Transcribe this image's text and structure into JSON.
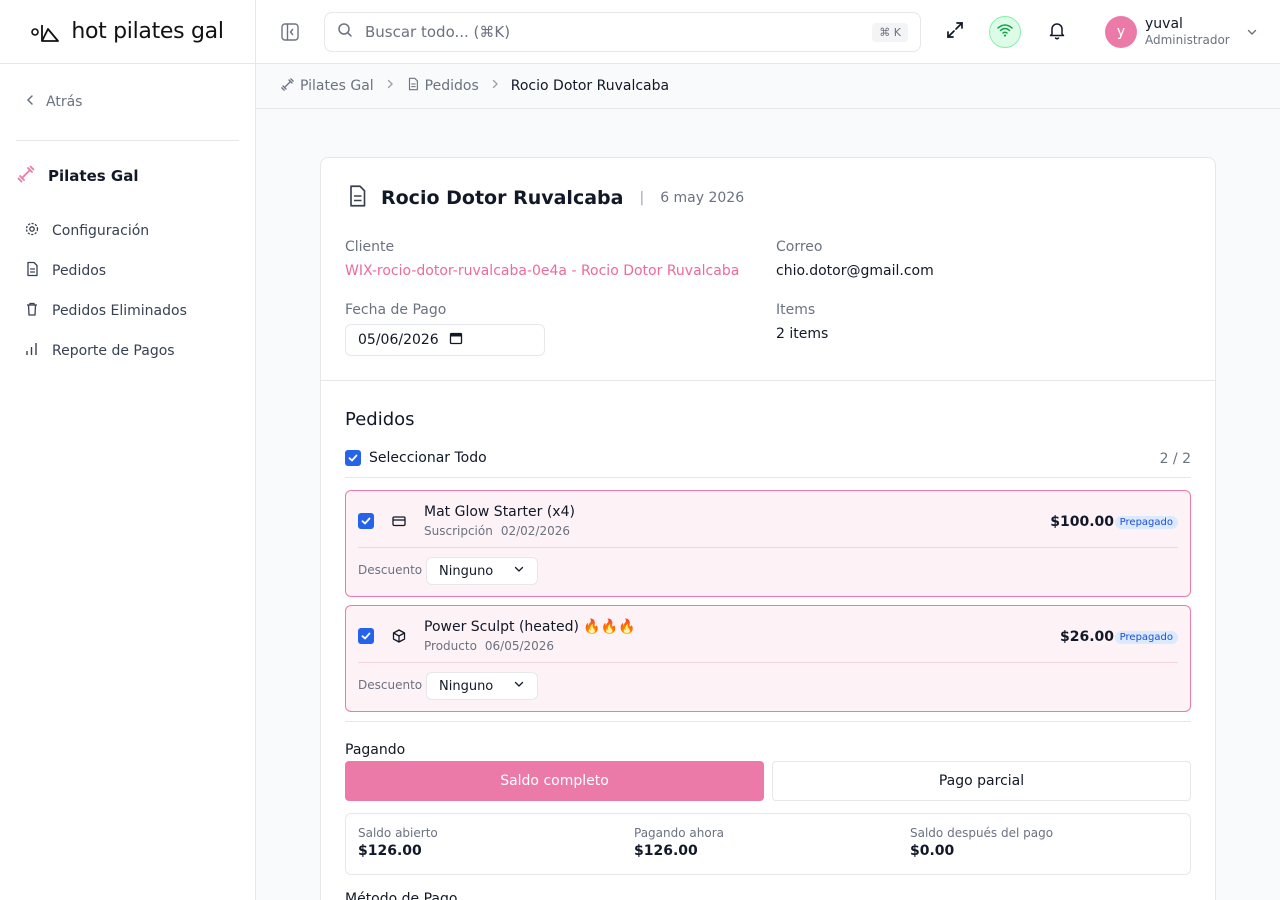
{
  "app": {
    "logo_text": "hot pilates gal",
    "accent": "#ec7aa9"
  },
  "sidebar": {
    "back_label": "Atrás",
    "org_name": "Pilates Gal",
    "items": [
      {
        "label": "Configuración",
        "icon": "gear-icon"
      },
      {
        "label": "Pedidos",
        "icon": "document-icon"
      },
      {
        "label": "Pedidos Eliminados",
        "icon": "trash-icon"
      },
      {
        "label": "Reporte de Pagos",
        "icon": "bar-chart-icon"
      }
    ]
  },
  "header": {
    "search_placeholder": "Buscar todo... (⌘K)",
    "search_shortcut": "⌘ K",
    "user_initial": "y",
    "user_name": "yuval",
    "user_role": "Administrador"
  },
  "breadcrumb": [
    "Pilates Gal",
    "Pedidos",
    "Rocio Dotor Ruvalcaba"
  ],
  "order": {
    "title": "Rocio Dotor Ruvalcaba",
    "date": "6 may 2026",
    "client_label": "Cliente",
    "client_value": "WIX-rocio-dotor-ruvalcaba-0e4a - Rocio Dotor Ruvalcaba",
    "email_label": "Correo",
    "email_value": "chio.dotor@gmail.com",
    "payment_date_label": "Fecha de Pago",
    "payment_date_value": "05/06/2026",
    "items_label": "Items",
    "items_value": "2 items"
  },
  "orders_section": {
    "title": "Pedidos",
    "select_all_label": "Seleccionar Todo",
    "selected_count": "2 / 2",
    "discount_label": "Descuento",
    "items": [
      {
        "name": "Mat Glow Starter (x4)",
        "type": "Suscripción",
        "date": "02/02/2026",
        "price": "$100.00",
        "status": "Prepagado",
        "discount": "Ninguno",
        "icon": "credit-card-icon",
        "checked": true
      },
      {
        "name": "Power Sculpt (heated) 🔥🔥🔥",
        "type": "Producto",
        "date": "06/05/2026",
        "price": "$26.00",
        "status": "Prepagado",
        "discount": "Ninguno",
        "icon": "box-icon",
        "checked": true
      }
    ]
  },
  "payment": {
    "label": "Pagando",
    "full_label": "Saldo completo",
    "partial_label": "Pago parcial",
    "open_balance_label": "Saldo abierto",
    "open_balance_value": "$126.00",
    "paying_now_label": "Pagando ahora",
    "paying_now_value": "$126.00",
    "after_label": "Saldo después del pago",
    "after_value": "$0.00",
    "method_label": "Método de Pago"
  }
}
